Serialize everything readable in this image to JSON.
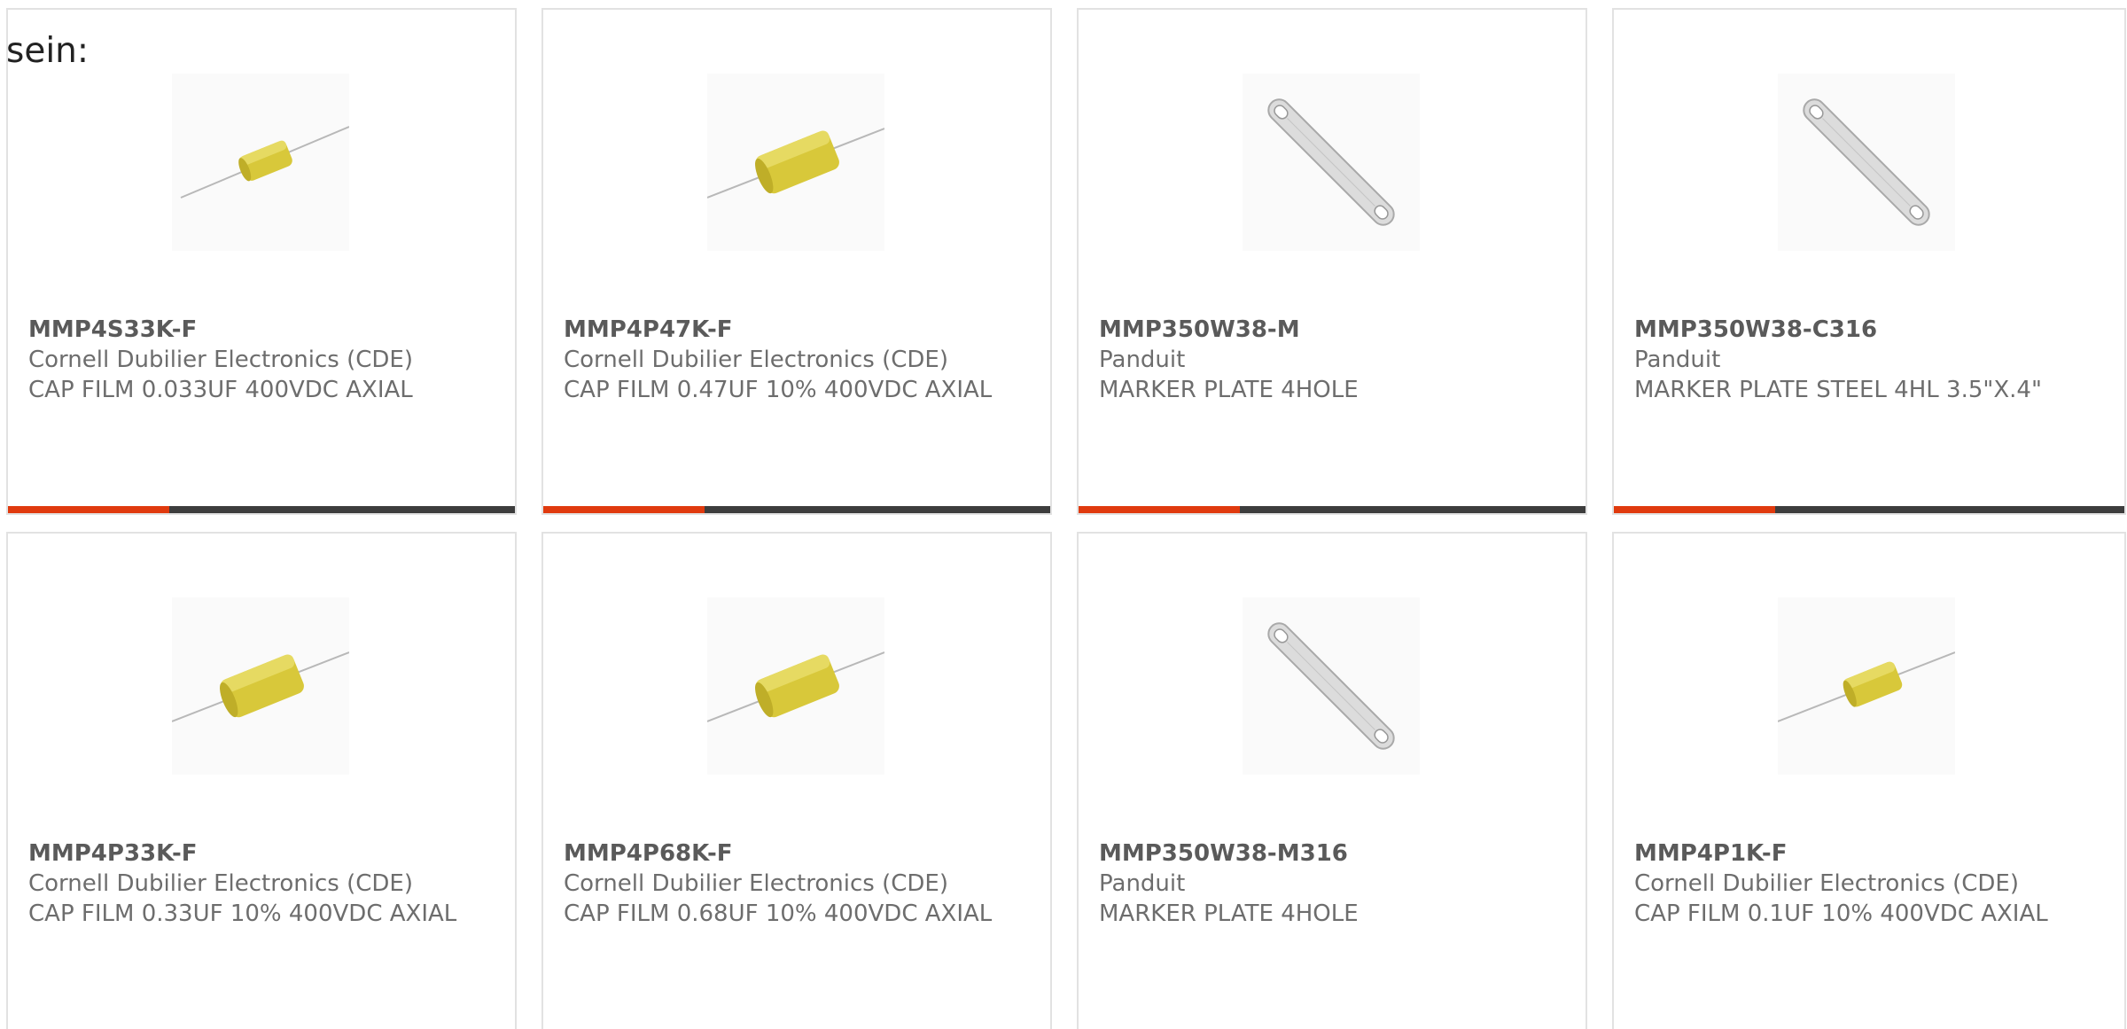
{
  "intro_text": "sein:",
  "colors": {
    "accent": "#e03a0e",
    "bar": "#3d3d3d",
    "border": "#e2e2e2",
    "capacitor_body": "#dccb3a",
    "marker_plate": "#d8d8d8"
  },
  "products": [
    {
      "part_number": "MMP4S33K-F",
      "manufacturer": "Cornell Dubilier Electronics (CDE)",
      "description": "CAP FILM 0.033UF 400VDC AXIAL",
      "image_icon": "axial-film-capacitor-icon"
    },
    {
      "part_number": "MMP4P47K-F",
      "manufacturer": "Cornell Dubilier Electronics (CDE)",
      "description": "CAP FILM 0.47UF 10% 400VDC AXIAL",
      "image_icon": "axial-film-capacitor-icon"
    },
    {
      "part_number": "MMP350W38-M",
      "manufacturer": "Panduit",
      "description": "MARKER PLATE 4HOLE",
      "image_icon": "marker-plate-icon"
    },
    {
      "part_number": "MMP350W38-C316",
      "manufacturer": "Panduit",
      "description": "MARKER PLATE STEEL 4HL 3.5\"X.4\"",
      "image_icon": "marker-plate-icon"
    },
    {
      "part_number": "MMP4P33K-F",
      "manufacturer": "Cornell Dubilier Electronics (CDE)",
      "description": "CAP FILM 0.33UF 10% 400VDC AXIAL",
      "image_icon": "axial-film-capacitor-icon"
    },
    {
      "part_number": "MMP4P68K-F",
      "manufacturer": "Cornell Dubilier Electronics (CDE)",
      "description": "CAP FILM 0.68UF 10% 400VDC AXIAL",
      "image_icon": "axial-film-capacitor-icon"
    },
    {
      "part_number": "MMP350W38-M316",
      "manufacturer": "Panduit",
      "description": "MARKER PLATE 4HOLE",
      "image_icon": "marker-plate-icon"
    },
    {
      "part_number": "MMP4P1K-F",
      "manufacturer": "Cornell Dubilier Electronics (CDE)",
      "description": "CAP FILM 0.1UF 10% 400VDC AXIAL",
      "image_icon": "axial-film-capacitor-icon"
    }
  ]
}
